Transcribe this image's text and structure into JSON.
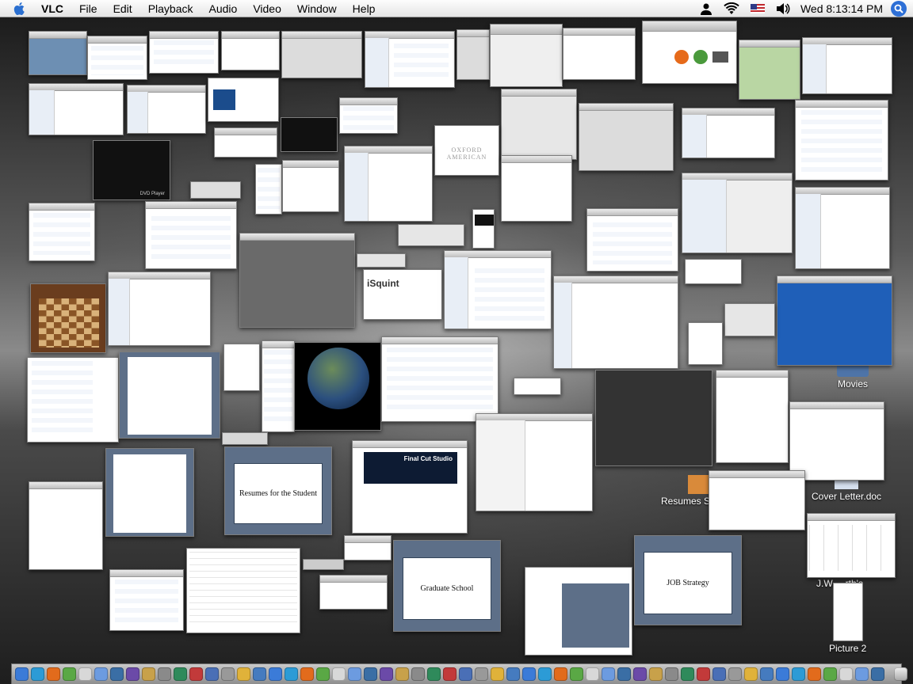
{
  "menubar": {
    "app_name": "VLC",
    "items": [
      "File",
      "Edit",
      "Playback",
      "Audio",
      "Video",
      "Window",
      "Help"
    ],
    "clock": "Wed 8:13:14 PM"
  },
  "desktop_icons": {
    "movies": "Movies",
    "resumes": "Resumes Student",
    "cover_letter": "Cover Letter.doc",
    "jw": "J.W. ...rth's",
    "picture2": "Picture 2"
  },
  "windows": {
    "resumes_title": "Resumes for the Student",
    "grad_school": "Graduate School",
    "job_strategy": "JOB Strategy",
    "final_cut": "Final Cut Studio",
    "isquint": "iSquint",
    "oxford": "OXFORD AMERICAN",
    "dvd_player": "DVD Player"
  },
  "colors": {
    "accent": "#2d6fd6",
    "slide_frame": "#5d6f88",
    "desktop_dark": "#1c1c1c"
  },
  "dock": {
    "icon_names": [
      "finder-icon",
      "safari-icon",
      "firefox-icon",
      "itunes-icon",
      "ical-icon",
      "mail-icon",
      "iphoto-icon",
      "imovie-icon",
      "app-icon",
      "app-icon",
      "app-icon",
      "app-icon",
      "app-icon",
      "app-icon",
      "app-icon",
      "app-icon",
      "app-icon",
      "app-icon",
      "app-icon",
      "app-icon",
      "app-icon",
      "app-icon",
      "app-icon",
      "app-icon",
      "app-icon",
      "app-icon",
      "app-icon",
      "app-icon",
      "app-icon",
      "app-icon",
      "app-icon",
      "app-icon",
      "app-icon",
      "app-icon",
      "app-icon",
      "app-icon",
      "app-icon",
      "app-icon",
      "app-icon",
      "app-icon",
      "app-icon",
      "app-icon",
      "app-icon",
      "app-icon",
      "app-icon",
      "app-icon",
      "app-icon",
      "app-icon",
      "app-icon",
      "app-icon",
      "app-icon",
      "app-icon",
      "app-icon",
      "app-icon",
      "app-icon",
      "trash-icon"
    ]
  }
}
